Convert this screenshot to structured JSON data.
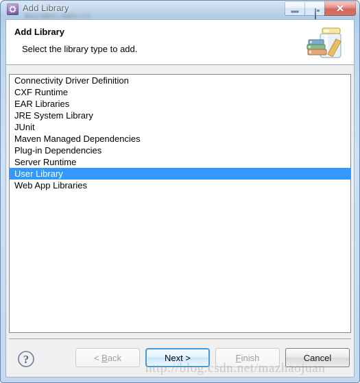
{
  "window": {
    "title": "Add Library",
    "icon": "gear-icon",
    "caption_buttons": {
      "minimize": "minimize-icon",
      "maximize": "restore-icon",
      "close": "✕"
    }
  },
  "banner": {
    "title": "Add Library",
    "subtitle": "Select the library type to add.",
    "image": "jar-with-books-icon"
  },
  "library_list": {
    "selected_index": 8,
    "items": [
      "Connectivity Driver Definition",
      "CXF Runtime",
      "EAR Libraries",
      "JRE System Library",
      "JUnit",
      "Maven Managed Dependencies",
      "Plug-in Dependencies",
      "Server Runtime",
      "User Library",
      "Web App Libraries"
    ]
  },
  "footer": {
    "help_icon": "question-mark-icon",
    "buttons": [
      {
        "label": "< Back",
        "mnemonic": "B",
        "state": "disabled",
        "name": "back-button"
      },
      {
        "label": "Next >",
        "mnemonic": "",
        "state": "default",
        "name": "next-button"
      },
      {
        "label": "Finish",
        "mnemonic": "F",
        "state": "disabled",
        "name": "finish-button"
      },
      {
        "label": "Cancel",
        "mnemonic": "",
        "state": "enabled",
        "name": "cancel-button"
      }
    ]
  },
  "watermark": "http://blog.csdn.net/mazhaojuan",
  "colors": {
    "selection_blue": "#3399ff",
    "title_bar": "#c2d9ef",
    "close_red": "#bb3226",
    "default_button_border": "#3c9ddb"
  }
}
